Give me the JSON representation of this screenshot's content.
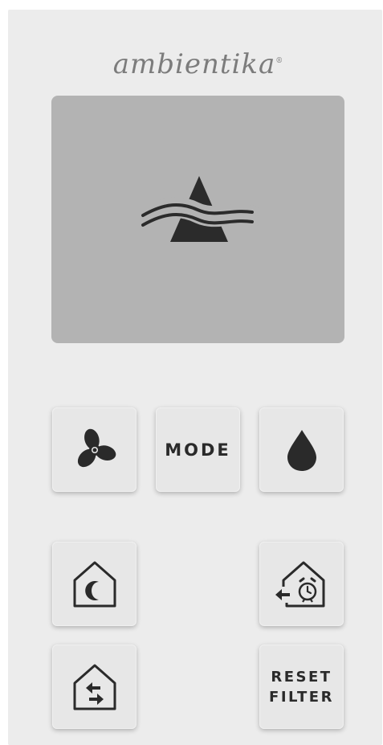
{
  "brand": {
    "name": "ambientika",
    "registered_mark": "®"
  },
  "display": {
    "icon": "ambientika-logo-icon"
  },
  "buttons": {
    "fan": {
      "icon": "fan-icon"
    },
    "mode": {
      "label": "MODE"
    },
    "humidity": {
      "icon": "water-drop-icon"
    },
    "night": {
      "icon": "house-moon-icon"
    },
    "timer": {
      "icon": "house-alarm-clock-icon"
    },
    "exchange": {
      "icon": "house-arrows-icon"
    },
    "reset_filter": {
      "line1": "RESET",
      "line2": "FILTER"
    }
  },
  "colors": {
    "body": "#ececec",
    "screen": "#b3b3b3",
    "button": "#e7e7e7",
    "icon": "#2a2a2a"
  }
}
